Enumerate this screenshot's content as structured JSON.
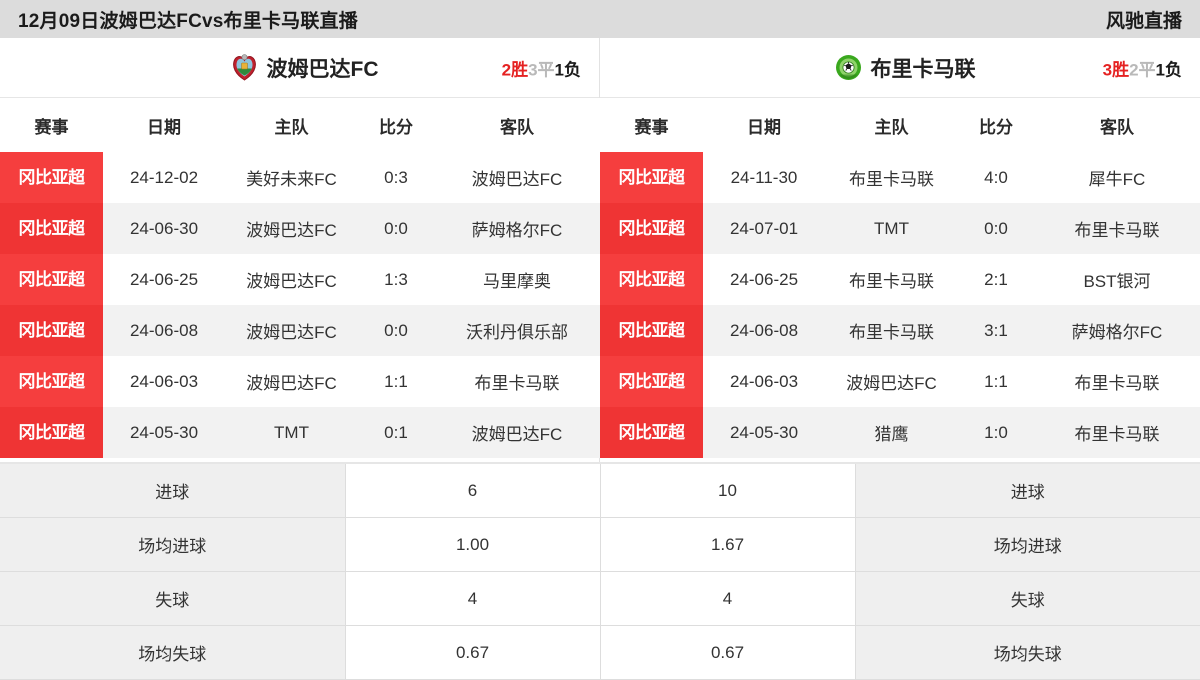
{
  "topbar": {
    "title": "12月09日波姆巴达FCvs布里卡马联直播",
    "brand": "风驰直播",
    "bg_color": "#dcdcdc"
  },
  "colors": {
    "league_badge": "#f53e3e",
    "league_badge_alt": "#ef3434",
    "win": "#e52222",
    "draw": "#b9b9b9",
    "loss": "#1a1a1a",
    "row_alt": "#f2f2f2",
    "stats_label_bg": "#efefef"
  },
  "left_pane": {
    "team": {
      "name": "波姆巴达FC",
      "crest_icon": "shield-crest-icon",
      "crest_color": "#c0202c"
    },
    "record": {
      "wins": "2",
      "wins_label": "胜",
      "draws": "3",
      "draws_label": "平",
      "losses": "1",
      "losses_label": "负"
    },
    "columns": [
      "赛事",
      "日期",
      "主队",
      "比分",
      "客队"
    ],
    "matches": [
      {
        "league": "冈比亚超",
        "date": "24-12-02",
        "home": "美好未来FC",
        "score": "0:3",
        "away": "波姆巴达FC"
      },
      {
        "league": "冈比亚超",
        "date": "24-06-30",
        "home": "波姆巴达FC",
        "score": "0:0",
        "away": "萨姆格尔FC"
      },
      {
        "league": "冈比亚超",
        "date": "24-06-25",
        "home": "波姆巴达FC",
        "score": "1:3",
        "away": "马里摩奥"
      },
      {
        "league": "冈比亚超",
        "date": "24-06-08",
        "home": "波姆巴达FC",
        "score": "0:0",
        "away": "沃利丹俱乐部"
      },
      {
        "league": "冈比亚超",
        "date": "24-06-03",
        "home": "波姆巴达FC",
        "score": "1:1",
        "away": "布里卡马联"
      },
      {
        "league": "冈比亚超",
        "date": "24-05-30",
        "home": "TMT",
        "score": "0:1",
        "away": "波姆巴达FC"
      }
    ]
  },
  "right_pane": {
    "team": {
      "name": "布里卡马联",
      "crest_icon": "football-crest-icon",
      "crest_color": "#3aa81e"
    },
    "record": {
      "wins": "3",
      "wins_label": "胜",
      "draws": "2",
      "draws_label": "平",
      "losses": "1",
      "losses_label": "负"
    },
    "columns": [
      "赛事",
      "日期",
      "主队",
      "比分",
      "客队"
    ],
    "matches": [
      {
        "league": "冈比亚超",
        "date": "24-11-30",
        "home": "布里卡马联",
        "score": "4:0",
        "away": "犀牛FC"
      },
      {
        "league": "冈比亚超",
        "date": "24-07-01",
        "home": "TMT",
        "score": "0:0",
        "away": "布里卡马联"
      },
      {
        "league": "冈比亚超",
        "date": "24-06-25",
        "home": "布里卡马联",
        "score": "2:1",
        "away": "BST银河"
      },
      {
        "league": "冈比亚超",
        "date": "24-06-08",
        "home": "布里卡马联",
        "score": "3:1",
        "away": "萨姆格尔FC"
      },
      {
        "league": "冈比亚超",
        "date": "24-06-03",
        "home": "波姆巴达FC",
        "score": "1:1",
        "away": "布里卡马联"
      },
      {
        "league": "冈比亚超",
        "date": "24-05-30",
        "home": "猎鹰",
        "score": "1:0",
        "away": "布里卡马联"
      }
    ]
  },
  "stats": [
    {
      "left_label": "进球",
      "left_value": "6",
      "right_value": "10",
      "right_label": "进球"
    },
    {
      "left_label": "场均进球",
      "left_value": "1.00",
      "right_value": "1.67",
      "right_label": "场均进球"
    },
    {
      "left_label": "失球",
      "left_value": "4",
      "right_value": "4",
      "right_label": "失球"
    },
    {
      "left_label": "场均失球",
      "left_value": "0.67",
      "right_value": "0.67",
      "right_label": "场均失球"
    }
  ]
}
